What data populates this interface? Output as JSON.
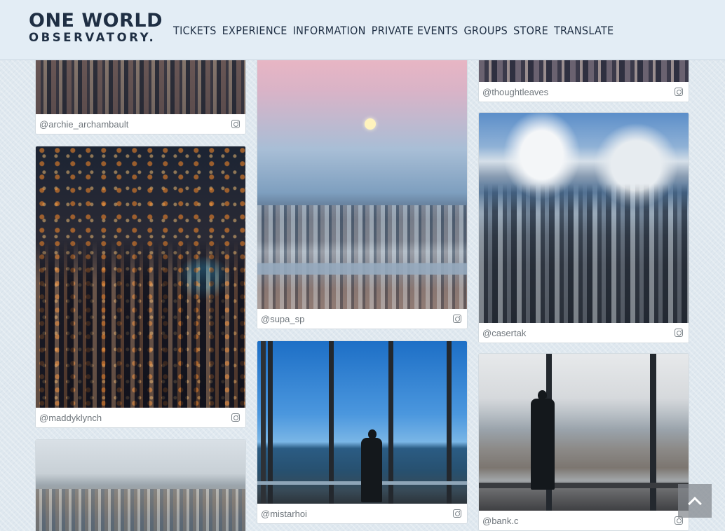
{
  "header": {
    "logo_line1": "ONE WORLD",
    "logo_line2": "OBSERVATORY.",
    "nav": [
      "TICKETS",
      "EXPERIENCE",
      "INFORMATION",
      "PRIVATE EVENTS",
      "GROUPS",
      "STORE",
      "TRANSLATE"
    ]
  },
  "feed": {
    "col1": [
      {
        "user": "@archie_archambault",
        "photo": "city-dusk-aerial"
      },
      {
        "user": "@maddyklynch",
        "photo": "city-night-aerial"
      },
      {
        "user": "",
        "photo": "harbor-aerial"
      }
    ],
    "col2": [
      {
        "user": "@supa_sp",
        "photo": "sunset-river-moon"
      },
      {
        "user": "@mistarhoi",
        "photo": "observatory-windows-silhouette"
      }
    ],
    "col3": [
      {
        "user": "@thoughtleaves",
        "photo": "city-dusk-partial"
      },
      {
        "user": "@casertak",
        "photo": "clouds-city-aerial"
      },
      {
        "user": "@bank.c",
        "photo": "overcast-window-silhouette"
      }
    ]
  },
  "icons": {
    "instagram": "instagram-icon",
    "back_to_top": "chevron-up-icon"
  },
  "colors": {
    "brand": "#1f2f44",
    "header_bg": "#e3edf5",
    "caption_text": "#6f767c"
  }
}
